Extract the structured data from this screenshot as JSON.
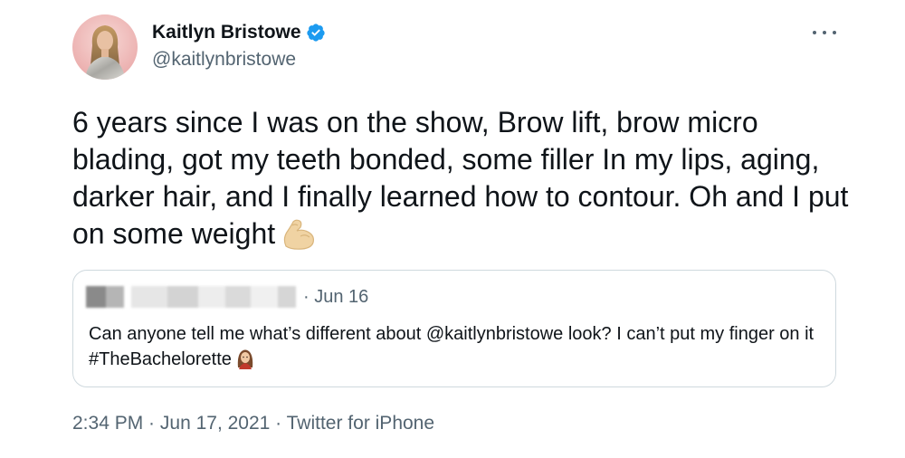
{
  "author": {
    "display_name": "Kaitlyn Bristowe",
    "handle": "@kaitlynbristowe",
    "verified_icon": "verified-badge-icon"
  },
  "tweet": {
    "text": "6 years since I was on the show, Brow lift, brow micro blading, got my teeth bonded, some filler In my lips, aging, darker hair, and I finally learned how to contour. Oh and I put on some weight",
    "emoji": "flexed-biceps-icon"
  },
  "quoted_tweet": {
    "date": "· Jun 16",
    "text": "Can anyone tell me what’s different about @kaitlynbristowe look? I can’t put my finger on it #TheBachelorette",
    "emoji": "woman-emoji-icon"
  },
  "meta": {
    "time": "2:34 PM",
    "separator": " · ",
    "date": "Jun 17, 2021",
    "source": "Twitter for iPhone"
  },
  "colors": {
    "text_primary": "#0f1419",
    "text_secondary": "#536471",
    "verified_blue": "#1d9bf0",
    "quote_border": "#cfd9de"
  }
}
